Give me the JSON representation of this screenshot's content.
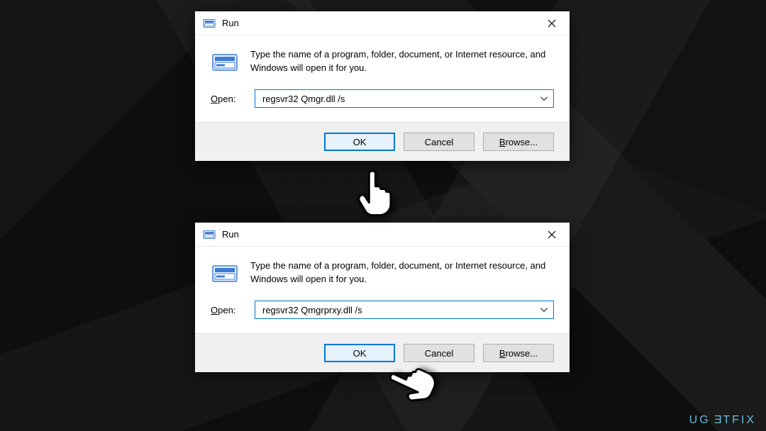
{
  "dialog1": {
    "title": "Run",
    "instruction": "Type the name of a program, folder, document, or Internet resource, and Windows will open it for you.",
    "open_label_pre": "O",
    "open_label_post": "pen:",
    "command": "regsvr32 Qmgr.dll /s",
    "buttons": {
      "ok": "OK",
      "cancel": "Cancel",
      "browse_pre": "B",
      "browse_post": "rowse..."
    }
  },
  "dialog2": {
    "title": "Run",
    "instruction": "Type the name of a program, folder, document, or Internet resource, and Windows will open it for you.",
    "open_label_pre": "O",
    "open_label_post": "pen:",
    "command": "regsvr32 Qmgrprxy.dll /s",
    "buttons": {
      "ok": "OK",
      "cancel": "Cancel",
      "browse_pre": "B",
      "browse_post": "rowse..."
    }
  },
  "watermark": "UG=TFIX"
}
